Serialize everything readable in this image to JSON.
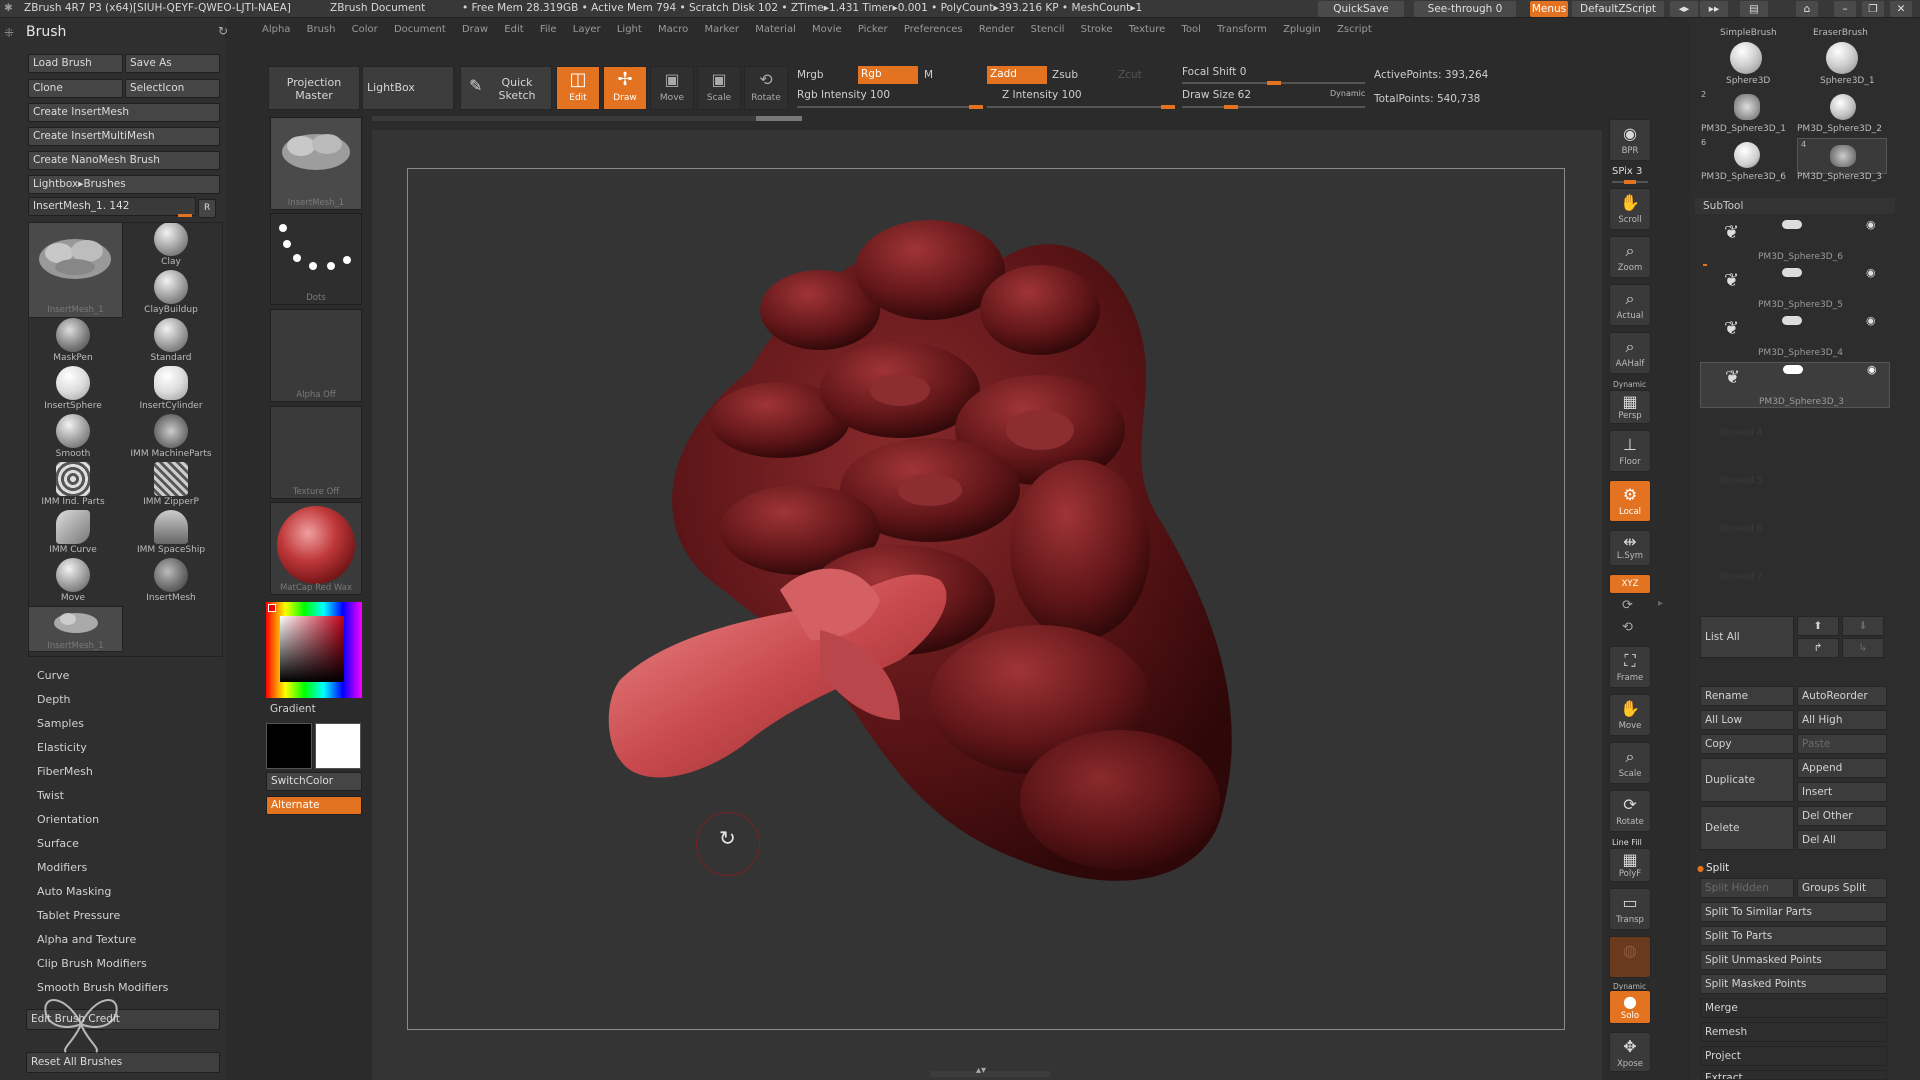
{
  "titlebar": {
    "app": "ZBrush 4R7 P3 (x64)[SIUH-QEYF-QWEO-LJTI-NAEA]",
    "doc": "ZBrush Document",
    "stats": "• Free Mem 28.319GB • Active Mem 794 • Scratch Disk 102 •  ZTime▸1.431 Timer▸0.001 • PolyCount▸393.216 KP  • MeshCount▸1",
    "quicksave": "QuickSave",
    "see_through": "See-through  0",
    "menus": "Menus",
    "script": "DefaultZScript"
  },
  "menubar": [
    "Alpha",
    "Brush",
    "Color",
    "Document",
    "Draw",
    "Edit",
    "File",
    "Layer",
    "Light",
    "Macro",
    "Marker",
    "Material",
    "Movie",
    "Picker",
    "Preferences",
    "Render",
    "Stencil",
    "Stroke",
    "Texture",
    "Tool",
    "Transform",
    "Zplugin",
    "Zscript"
  ],
  "brush_palette": {
    "title": "Brush",
    "load": "Load Brush",
    "save_as": "Save As",
    "clone": "Clone",
    "select_icon": "SelectIcon",
    "create_insert": "Create InsertMesh",
    "create_insert_multi": "Create InsertMultiMesh",
    "create_nano": "Create NanoMesh Brush",
    "lightbox_brushes": "Lightbox▸Brushes",
    "current": "InsertMesh_1. 142",
    "r": "R",
    "brushes": [
      {
        "label": "InsertMesh_1"
      },
      {
        "label": "Clay"
      },
      {
        "label": "ClayBuildup"
      },
      {
        "label": "MaskPen"
      },
      {
        "label": "Standard"
      },
      {
        "label": "InsertSphere"
      },
      {
        "label": "InsertCylinder"
      },
      {
        "label": "Smooth"
      },
      {
        "label": "IMM MachineParts"
      },
      {
        "label": "IMM Ind. Parts"
      },
      {
        "label": "IMM ZipperP"
      },
      {
        "label": "IMM Curve"
      },
      {
        "label": "IMM SpaceShip"
      },
      {
        "label": "Move"
      },
      {
        "label": "InsertMesh"
      },
      {
        "label": "InsertMesh_1"
      }
    ],
    "sections": [
      "Curve",
      "Depth",
      "Samples",
      "Elasticity",
      "FiberMesh",
      "Twist",
      "Orientation",
      "Surface",
      "Modifiers",
      "Auto Masking",
      "Tablet Pressure",
      "Alpha and Texture",
      "Clip Brush Modifiers",
      "Smooth Brush Modifiers"
    ],
    "edit_credit": "Edit Brush Credit",
    "reset_all": "Reset All Brushes"
  },
  "left_strip": {
    "insertmesh": "InsertMesh_1",
    "dots": "Dots",
    "alpha": "Alpha  Off",
    "texture": "Texture  Off",
    "material": "MatCap  Red  Wax",
    "gradient": "Gradient",
    "switch_color": "SwitchColor",
    "alternate": "Alternate"
  },
  "shelf": {
    "projection_master": "Projection Master",
    "lightbox": "LightBox",
    "quick_sketch": "Quick Sketch",
    "edit": "Edit",
    "draw": "Draw",
    "move": "Move",
    "scale": "Scale",
    "rotate": "Rotate",
    "mrgb": "Mrgb",
    "rgb": "Rgb",
    "m": "M",
    "rgb_intensity": "Rgb  Intensity 100",
    "zadd": "Zadd",
    "zsub": "Zsub",
    "zcut": "Zcut",
    "z_intensity": "Z  Intensity 100",
    "focal_shift": "Focal Shift 0",
    "draw_size": "Draw Size 62",
    "dynamic": "Dynamic",
    "active_points": "ActivePoints: 393,264",
    "total_points": "TotalPoints: 540,738",
    "focal_level": 0.5,
    "draw_size_level": 0.25
  },
  "right_strip": [
    {
      "name": "bpr",
      "label": "BPR",
      "icon": "◉"
    },
    {
      "name": "spix",
      "label": "SPix 3",
      "icon": ""
    },
    {
      "name": "scroll",
      "label": "Scroll",
      "icon": "✋"
    },
    {
      "name": "zoom",
      "label": "Zoom",
      "icon": "🔍"
    },
    {
      "name": "actual",
      "label": "Actual",
      "icon": "⌕"
    },
    {
      "name": "aahalf",
      "label": "AAHalf",
      "icon": "⌕"
    },
    {
      "name": "persp",
      "label": "Persp",
      "icon": "▦"
    },
    {
      "name": "floor",
      "label": "Floor",
      "icon": "⊥"
    },
    {
      "name": "local",
      "label": "Local",
      "icon": "⚙"
    },
    {
      "name": "lsym",
      "label": "L.Sym",
      "icon": "⇹"
    },
    {
      "name": "xyz",
      "label": "XYZ",
      "icon": ""
    },
    {
      "name": "frame",
      "label": "Frame",
      "icon": "⛶"
    },
    {
      "name": "move",
      "label": "Move",
      "icon": "✋"
    },
    {
      "name": "scale",
      "label": "Scale",
      "icon": "⌕"
    },
    {
      "name": "rotate",
      "label": "Rotate",
      "icon": "⟳"
    },
    {
      "name": "polyf",
      "label": "PolyF",
      "icon": "▦"
    },
    {
      "name": "transp",
      "label": "Transp",
      "icon": "▭"
    },
    {
      "name": "ghost",
      "label": "",
      "icon": ""
    },
    {
      "name": "solo",
      "label": "Solo",
      "icon": "●"
    },
    {
      "name": "xpose",
      "label": "Xpose",
      "icon": "✥"
    }
  ],
  "line_fill": "Line Fill",
  "dynamic_small": "Dynamic",
  "tool_palette": {
    "simple_brush": "SimpleBrush",
    "eraser_brush": "EraserBrush",
    "sphere3d": "Sphere3D",
    "sphere3d_1": "Sphere3D_1",
    "pm1": "PM3D_Sphere3D_1",
    "pm2": "PM3D_Sphere3D_2",
    "pm6": "PM3D_Sphere3D_6",
    "pm3": "PM3D_Sphere3D_3",
    "n2": "2",
    "n6": "6",
    "n4": "4",
    "subtool": "SubTool",
    "subtools": [
      "PM3D_Sphere3D_6",
      "PM3D_Sphere3D_5",
      "PM3D_Sphere3D_4",
      "PM3D_Sphere3D_3"
    ],
    "unused": [
      "Unused 4",
      "Unused 5",
      "Unused 6",
      "Unused 7"
    ],
    "list_all": "List  All",
    "rename": "Rename",
    "auto_reorder": "AutoReorder",
    "all_low": "All Low",
    "all_high": "All High",
    "copy": "Copy",
    "paste": "Paste",
    "append": "Append",
    "duplicate": "Duplicate",
    "insert": "Insert",
    "del_other": "Del Other",
    "delete": "Delete",
    "del_all": "Del All",
    "split": "Split",
    "split_hidden": "Split Hidden",
    "groups_split": "Groups Split",
    "split_similar": "Split To Similar Parts",
    "split_parts": "Split To Parts",
    "split_unmasked": "Split Unmasked Points",
    "split_masked": "Split Masked Points",
    "merge": "Merge",
    "remesh": "Remesh",
    "project": "Project",
    "extract": "Extract"
  }
}
